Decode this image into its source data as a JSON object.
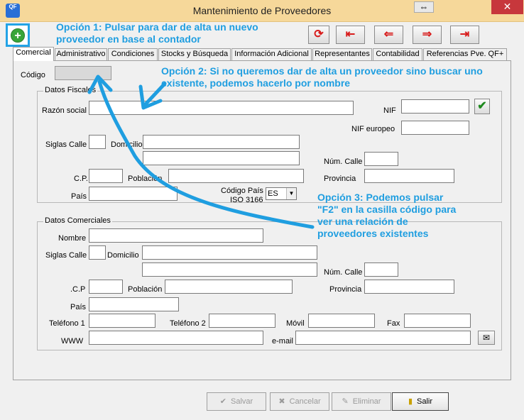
{
  "window": {
    "title": "Mantenimiento de Proveedores",
    "app_icon_text": "QF",
    "restore_glyph": "⇔",
    "close_glyph": "✕"
  },
  "toolbar": {
    "add_glyph": "+",
    "refresh_glyph": "⟳",
    "first_glyph": "⇤",
    "prev_glyph": "⇐",
    "next_glyph": "⇒",
    "last_glyph": "⇥"
  },
  "annotations": {
    "opcion1": "Opción 1: Pulsar para dar de alta un nuevo proveedor en base al contador",
    "opcion2": "Opción 2: Si no queremos dar de alta un proveedor sino buscar uno existente, podemos hacerlo por nombre",
    "opcion3": "Opción 3: Podemos pulsar \"F2\" en la casilla código para ver una relación de proveedores existentes"
  },
  "tabs": [
    "Comercial",
    "Administrativo",
    "Condiciones",
    "Stocks y Búsqueda",
    "Información Adicional",
    "Representantes",
    "Contabilidad",
    "Referencias Pve. QF+"
  ],
  "codigo": {
    "label": "Código",
    "value": ""
  },
  "fiscales": {
    "title": "Datos Fiscales",
    "razon_social": "Razón social",
    "nif": "NIF",
    "nif_europeo": "NIF europeo",
    "siglas_calle": "Siglas Calle",
    "domicilio": "Domicilio",
    "num_calle": "Núm. Calle",
    "cp": "C.P.",
    "poblacion": "Población",
    "provincia": "Provincia",
    "pais": "País",
    "codigo_pais": "Código País",
    "iso": "ISO 3166",
    "iso_value": "ES"
  },
  "comerciales": {
    "title": "Datos Comerciales",
    "nombre": "Nombre",
    "siglas_calle": "Siglas Calle",
    "domicilio": "Domicilio",
    "num_calle": "Núm. Calle",
    "cp": ".C.P",
    "poblacion": "Población",
    "provincia": "Provincia",
    "pais": "País",
    "telefono1": "Teléfono 1",
    "telefono2": "Teléfono 2",
    "movil": "Móvil",
    "fax": "Fax",
    "www": "WWW",
    "email": "e-mail"
  },
  "footer": {
    "salvar": "Salvar",
    "cancelar": "Cancelar",
    "eliminar": "Eliminar",
    "salir": "Salir"
  },
  "colors": {
    "annotation": "#1f9ee0",
    "titlebar": "#f6d89a",
    "close": "#c7373c"
  }
}
